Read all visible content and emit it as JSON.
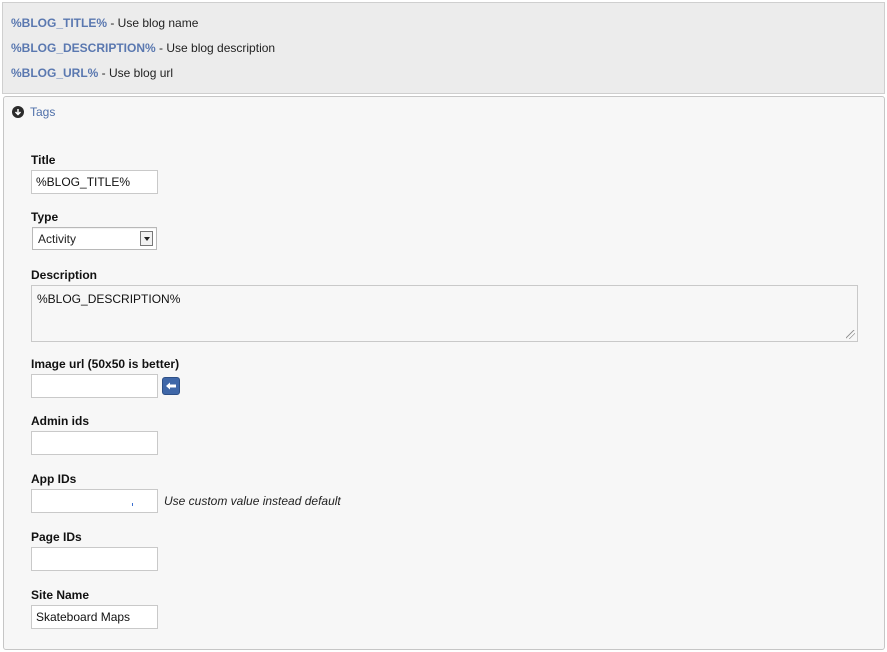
{
  "help": {
    "items": [
      {
        "var": "%BLOG_TITLE%",
        "desc": " - Use blog name"
      },
      {
        "var": "%BLOG_DESCRIPTION%",
        "desc": " - Use blog description"
      },
      {
        "var": "%BLOG_URL%",
        "desc": " - Use blog url"
      }
    ]
  },
  "section": {
    "toggle_label": "Tags",
    "toggle_icon": "circle-arrow-down-icon"
  },
  "fields": {
    "title": {
      "label": "Title",
      "value": "%BLOG_TITLE%"
    },
    "type": {
      "label": "Type",
      "selected": "Activity"
    },
    "description": {
      "label": "Description",
      "value": "%BLOG_DESCRIPTION%"
    },
    "image_url": {
      "label": "Image url (50x50 is better)",
      "value": "",
      "button_icon": "upload-arrow-icon"
    },
    "admin_ids": {
      "label": "Admin ids",
      "value": ""
    },
    "app_ids": {
      "label": "App IDs",
      "value": "",
      "note": "Use custom value instead default"
    },
    "page_ids": {
      "label": "Page IDs",
      "value": ""
    },
    "site_name": {
      "label": "Site Name",
      "value": "Skateboard Maps"
    }
  },
  "colors": {
    "variable_text": "#5a78b0",
    "link": "#4e6fa9",
    "button": "#3f67a8"
  }
}
